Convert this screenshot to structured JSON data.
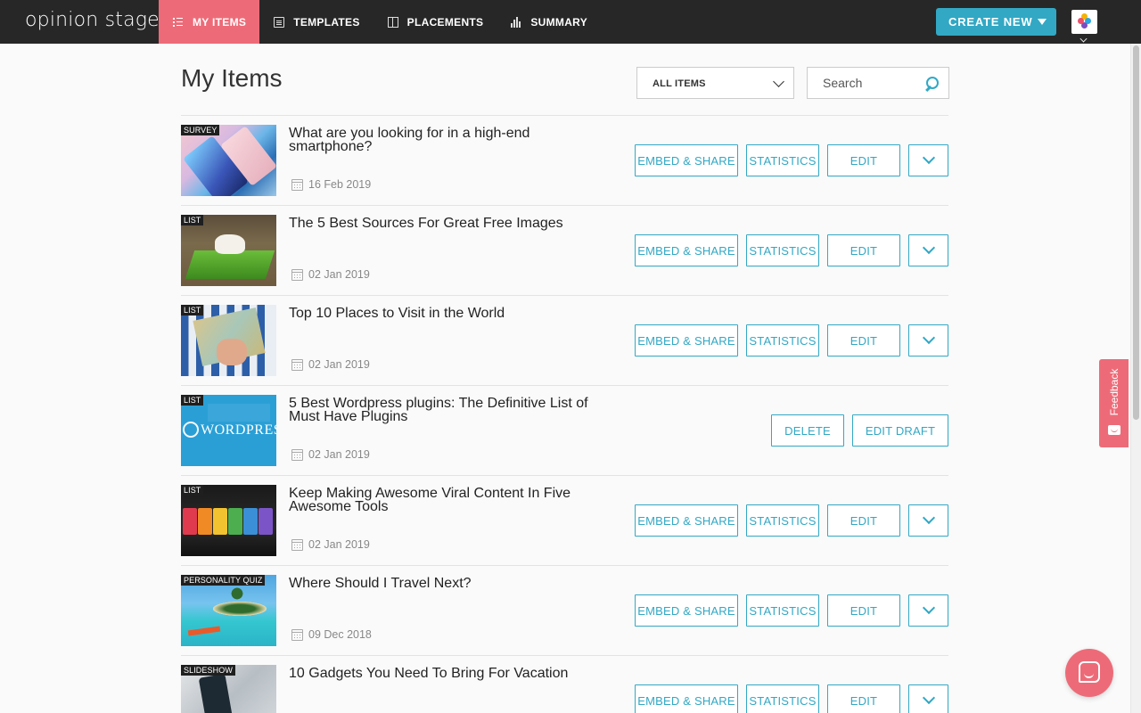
{
  "brand": {
    "name": "opinion stage"
  },
  "nav": {
    "items": [
      {
        "label": "MY ITEMS",
        "icon": "list-icon",
        "active": true
      },
      {
        "label": "TEMPLATES",
        "icon": "templates-icon",
        "active": false
      },
      {
        "label": "PLACEMENTS",
        "icon": "placements-icon",
        "active": false
      },
      {
        "label": "SUMMARY",
        "icon": "bar-chart-icon",
        "active": false
      }
    ],
    "create_label": "CREATE NEW"
  },
  "colors": {
    "topbar": "#272727",
    "accent": "#32a8c4",
    "brand_pink": "#ed6b78"
  },
  "page": {
    "title": "My Items",
    "filter": {
      "selected": "ALL ITEMS"
    },
    "search": {
      "placeholder": "Search",
      "value": ""
    }
  },
  "buttons": {
    "embed": "EMBED & SHARE",
    "statistics": "STATISTICS",
    "edit": "EDIT",
    "delete": "DELETE",
    "edit_draft": "EDIT DRAFT"
  },
  "items": [
    {
      "tag": "SURVEY",
      "title": "What are you looking for in a high-end smartphone?",
      "date": "16 Feb 2019",
      "draft": false
    },
    {
      "tag": "LIST",
      "title": "The 5 Best Sources For Great Free Images",
      "date": "02 Jan 2019",
      "draft": false
    },
    {
      "tag": "LIST",
      "title": "Top 10 Places to Visit in the World",
      "date": "02 Jan 2019",
      "draft": false
    },
    {
      "tag": "LIST",
      "title": "5 Best Wordpress plugins: The Definitive List of Must Have Plugins",
      "date": "02 Jan 2019",
      "draft": true,
      "thumb_text": "WORDPRESS"
    },
    {
      "tag": "LIST",
      "title": "Keep Making Awesome Viral Content In Five Awesome Tools",
      "date": "02 Jan 2019",
      "draft": false
    },
    {
      "tag": "PERSONALITY QUIZ",
      "title": "Where Should I Travel Next?",
      "date": "09 Dec 2018",
      "draft": false
    },
    {
      "tag": "SLIDESHOW",
      "title": "10 Gadgets You Need To Bring For Vacation",
      "date": "",
      "draft": false
    }
  ],
  "feedback": {
    "label": "Feedback"
  }
}
